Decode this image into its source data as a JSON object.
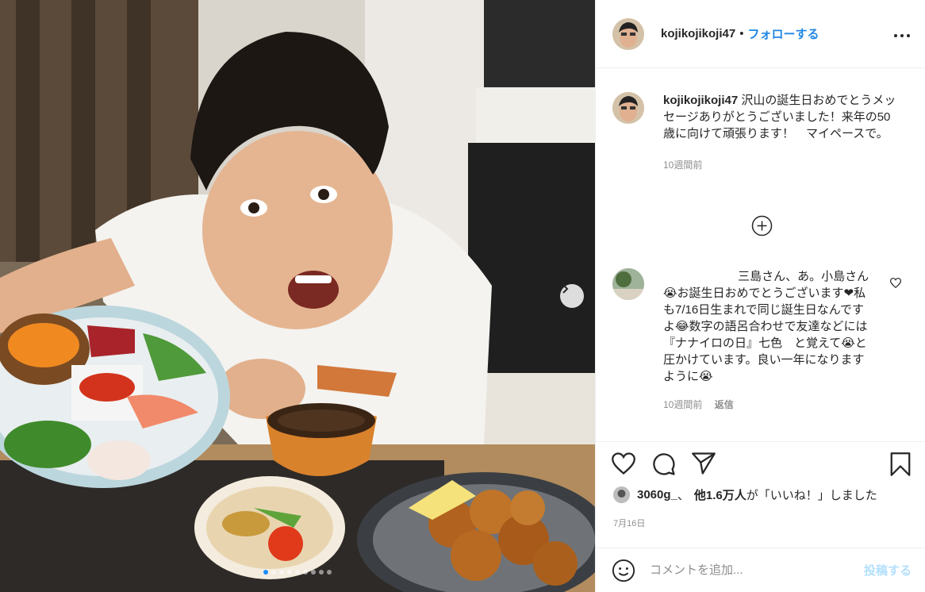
{
  "post": {
    "username": "kojikojikoji47",
    "separator": "•",
    "follow_label": "フォローする",
    "more_label": "•••"
  },
  "caption": {
    "username": "kojikojikoji47",
    "text": "沢山の誕生日おめでとうメッセージありがとうございました！来年の50歳に向けて頑張ります！　マイペースで。",
    "time": "10週間前"
  },
  "comment": {
    "username": "",
    "text": "三島さん、あ。小島さん😭お誕生日おめでとうございます❤私も7/16日生まれで同じ誕生日なんですよ😂数字の語呂合わせで友達などには『ナナイロの日』七色　と覚えて😭と圧かけています。良い一年になりますように😭",
    "time": "10週間前",
    "reply_label": "返信"
  },
  "likes": {
    "first_user": "3060g_",
    "text_mid": "、",
    "others": "他1.6万人",
    "text_end": "が「いいね！」しました"
  },
  "date": "7月16日",
  "add_comment": {
    "placeholder": "コメントを追加...",
    "post_label": "投稿する"
  },
  "carousel": {
    "total": 9,
    "active_index": 0
  },
  "colors": {
    "link": "#1f87e5",
    "muted": "#8e8e8e",
    "post_disabled": "#b2dffc",
    "dot_active": "#1a8cff"
  },
  "icons": [
    "heart-icon",
    "comment-icon",
    "share-icon",
    "bookmark-icon",
    "emoji-icon",
    "plus-circle-icon",
    "chevron-right-icon",
    "more-icon"
  ]
}
